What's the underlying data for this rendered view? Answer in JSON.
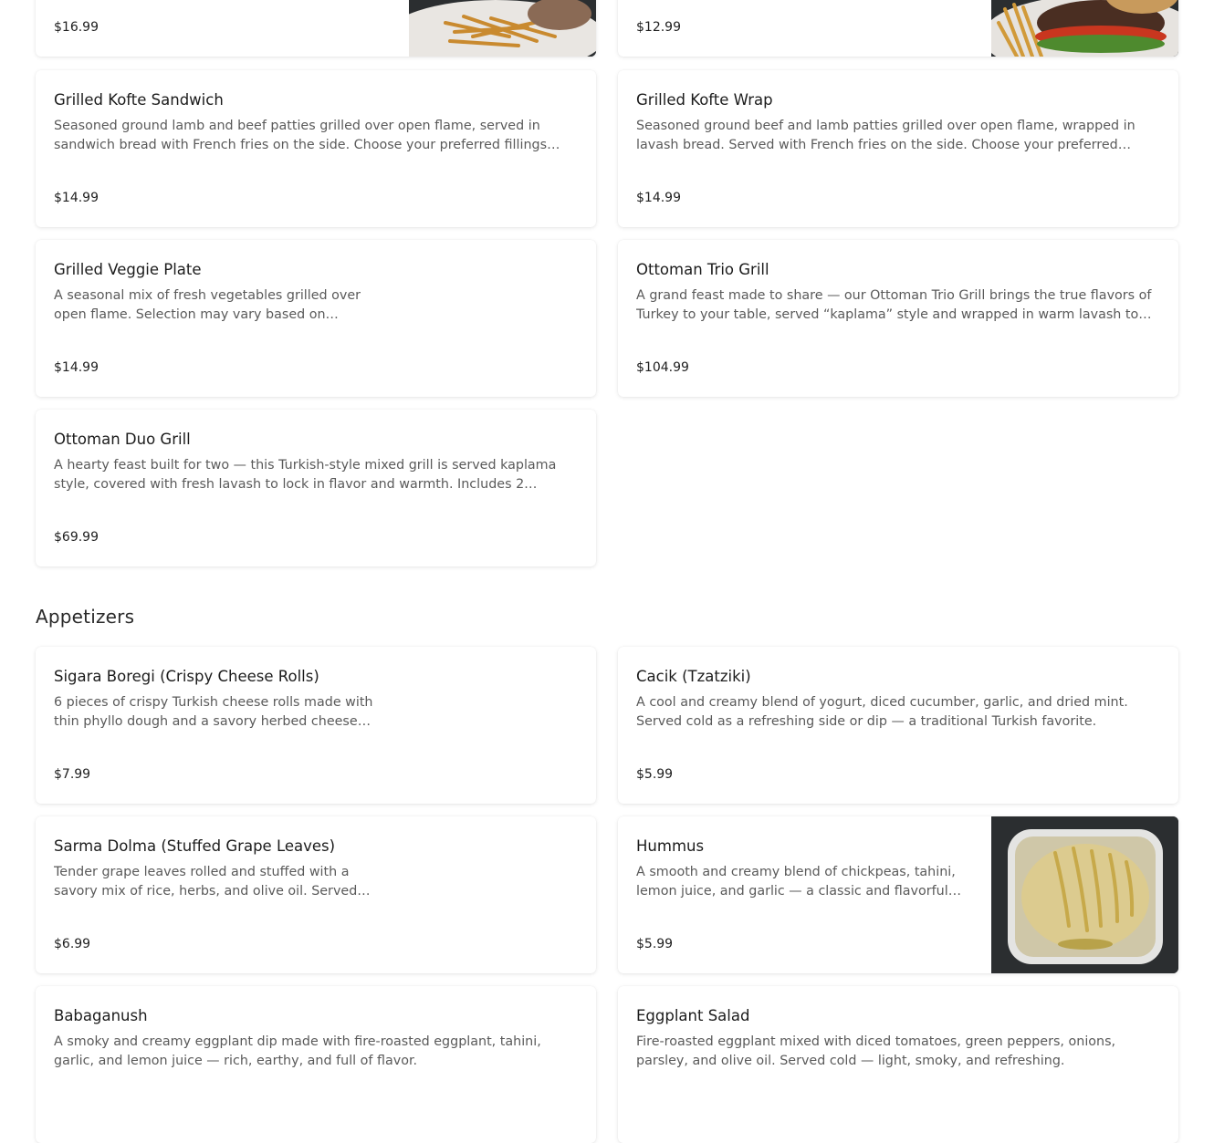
{
  "cut_top_cards": [
    {
      "price": "$16.99",
      "image": "plate-with-fries"
    },
    {
      "price": "$12.99",
      "image": "burger-with-fries"
    }
  ],
  "grills": [
    {
      "name": "Grilled Kofte Sandwich",
      "description": "Seasoned ground lamb and beef patties grilled over open flame, served in sandwich bread with French fries on the side. Choose your preferred fillings fr…",
      "price": "$14.99"
    },
    {
      "name": "Grilled Kofte Wrap",
      "description": "Seasoned ground beef and lamb patties grilled over open flame, wrapped in lavash bread. Served with French fries on the side. Choose your preferred fillin…",
      "price": "$14.99"
    },
    {
      "name": "Grilled Veggie Plate",
      "description": "A seasonal mix of fresh vegetables grilled over open flame. Selection may vary based on availab…",
      "price": "$14.99"
    },
    {
      "name": "Ottoman Trio Grill",
      "description": "A grand feast made to share — our Ottoman Trio Grill brings the true flavors of Turkey to your table, served “kaplama” style and wrapped in warm lavash to s…",
      "price": "$104.99"
    },
    {
      "name": "Ottoman Duo Grill",
      "description": "A hearty feast built for two — this Turkish-style mixed grill is served kaplama style, covered with fresh lavash to lock in flavor and warmth. Includes 2 Adana…",
      "price": "$69.99"
    }
  ],
  "appetizers_heading": "Appetizers",
  "appetizers": [
    {
      "name": "Sigara Boregi (Crispy Cheese Rolls)",
      "description": "6 pieces of crispy Turkish cheese rolls made with thin phyllo dough and a savory herbed cheese filli…",
      "price": "$7.99"
    },
    {
      "name": "Cacik (Tzatziki)",
      "description": "A cool and creamy blend of yogurt, diced cucumber, garlic, and dried mint. Served cold as a refreshing side or dip — a traditional Turkish favorite.",
      "price": "$5.99"
    },
    {
      "name": "Sarma Dolma (Stuffed Grape Leaves)",
      "description": "Tender grape leaves rolled and stuffed with a savory mix of rice, herbs, and olive oil. Served cold…",
      "price": "$6.99"
    },
    {
      "name": "Hummus",
      "description": "A smooth and creamy blend of chickpeas, tahini, lemon juice, and garlic — a classic and flavorful M…",
      "price": "$5.99",
      "image": "hummus-container"
    },
    {
      "name": "Babaganush",
      "description": "A smoky and creamy eggplant dip made with fire-roasted eggplant, tahini, garlic, and lemon juice — rich, earthy, and full of flavor."
    },
    {
      "name": "Eggplant Salad",
      "description": "Fire-roasted eggplant mixed with diced tomatoes, green peppers, onions, parsley, and olive oil. Served cold — light, smoky, and refreshing."
    }
  ]
}
